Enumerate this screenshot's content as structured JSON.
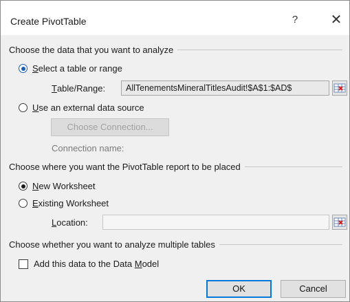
{
  "dialog": {
    "title": "Create PivotTable",
    "help_label": "?",
    "close_label": "✕"
  },
  "section_data": {
    "heading": "Choose the data that you want to analyze",
    "option_table": {
      "mnemonic": "S",
      "rest": "elect a table or range",
      "selected": true
    },
    "table_range_label": {
      "mnemonic": "T",
      "rest": "able/Range:"
    },
    "table_range_value": "AllTenementsMineralTitlesAudit!$A$1:$AD$",
    "option_external": {
      "mnemonic": "U",
      "rest": "se an external data source",
      "selected": false
    },
    "choose_connection_label": "Choose Connection...",
    "connection_name_label": "Connection name:"
  },
  "section_placement": {
    "heading": "Choose where you want the PivotTable report to be placed",
    "option_new": {
      "mnemonic": "N",
      "rest": "ew Worksheet",
      "selected": true
    },
    "option_existing": {
      "mnemonic": "E",
      "rest": "xisting Worksheet",
      "selected": false
    },
    "location_label": {
      "mnemonic": "L",
      "rest": "ocation:"
    },
    "location_value": ""
  },
  "section_multiple": {
    "heading": "Choose whether you want to analyze multiple tables",
    "checkbox": {
      "prefix": "Add this data to the Data ",
      "mnemonic": "M",
      "rest": "odel",
      "checked": false
    }
  },
  "buttons": {
    "ok_label": "OK",
    "cancel_label": "Cancel"
  },
  "colors": {
    "selected_radio": "#1a5fb4",
    "default_button_border": "#0078d7"
  },
  "icons": {
    "range_selector": "range-selector-icon"
  }
}
